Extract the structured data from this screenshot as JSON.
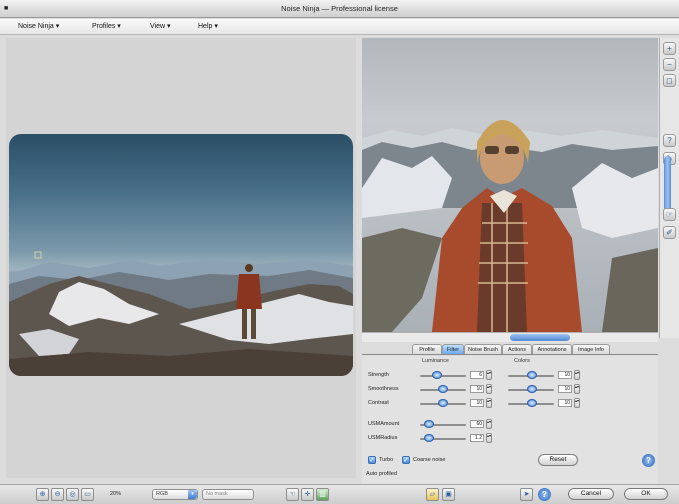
{
  "window": {
    "title": "Noise Ninja — Professional license"
  },
  "menus": [
    {
      "label": "Noise Ninja ▾"
    },
    {
      "label": "Profiles ▾"
    },
    {
      "label": "View ▾"
    },
    {
      "label": "Help ▾"
    }
  ],
  "tabs": [
    {
      "label": "Profile",
      "active": false
    },
    {
      "label": "Filter",
      "active": true
    },
    {
      "label": "Noise Brush",
      "active": false
    },
    {
      "label": "Actions",
      "active": false
    },
    {
      "label": "Annotations",
      "active": false
    },
    {
      "label": "Image Info",
      "active": false
    }
  ],
  "filter": {
    "luminance_header": "Luminance",
    "colors_header": "Colors",
    "rows": [
      {
        "label": "Strength",
        "lum_value": "6",
        "color_value": "10"
      },
      {
        "label": "Smoothness",
        "lum_value": "10",
        "color_value": "10"
      },
      {
        "label": "Contrast",
        "lum_value": "10",
        "color_value": "10"
      }
    ],
    "usm": [
      {
        "label": "USMAmount",
        "value": "60"
      },
      {
        "label": "USMRadius",
        "value": "1.2"
      }
    ],
    "turbo_label": "Turbo",
    "coarse_label": "Coarse noise",
    "reset_label": "Reset",
    "status": "Auto profiled"
  },
  "bottom": {
    "zoom": "20%",
    "channel": "RGB",
    "mask": "No mask",
    "cancel_label": "Cancel",
    "ok_label": "OK"
  },
  "colors": {
    "accent": "#3f7fd4",
    "tab_active": "#6aaaf0"
  }
}
